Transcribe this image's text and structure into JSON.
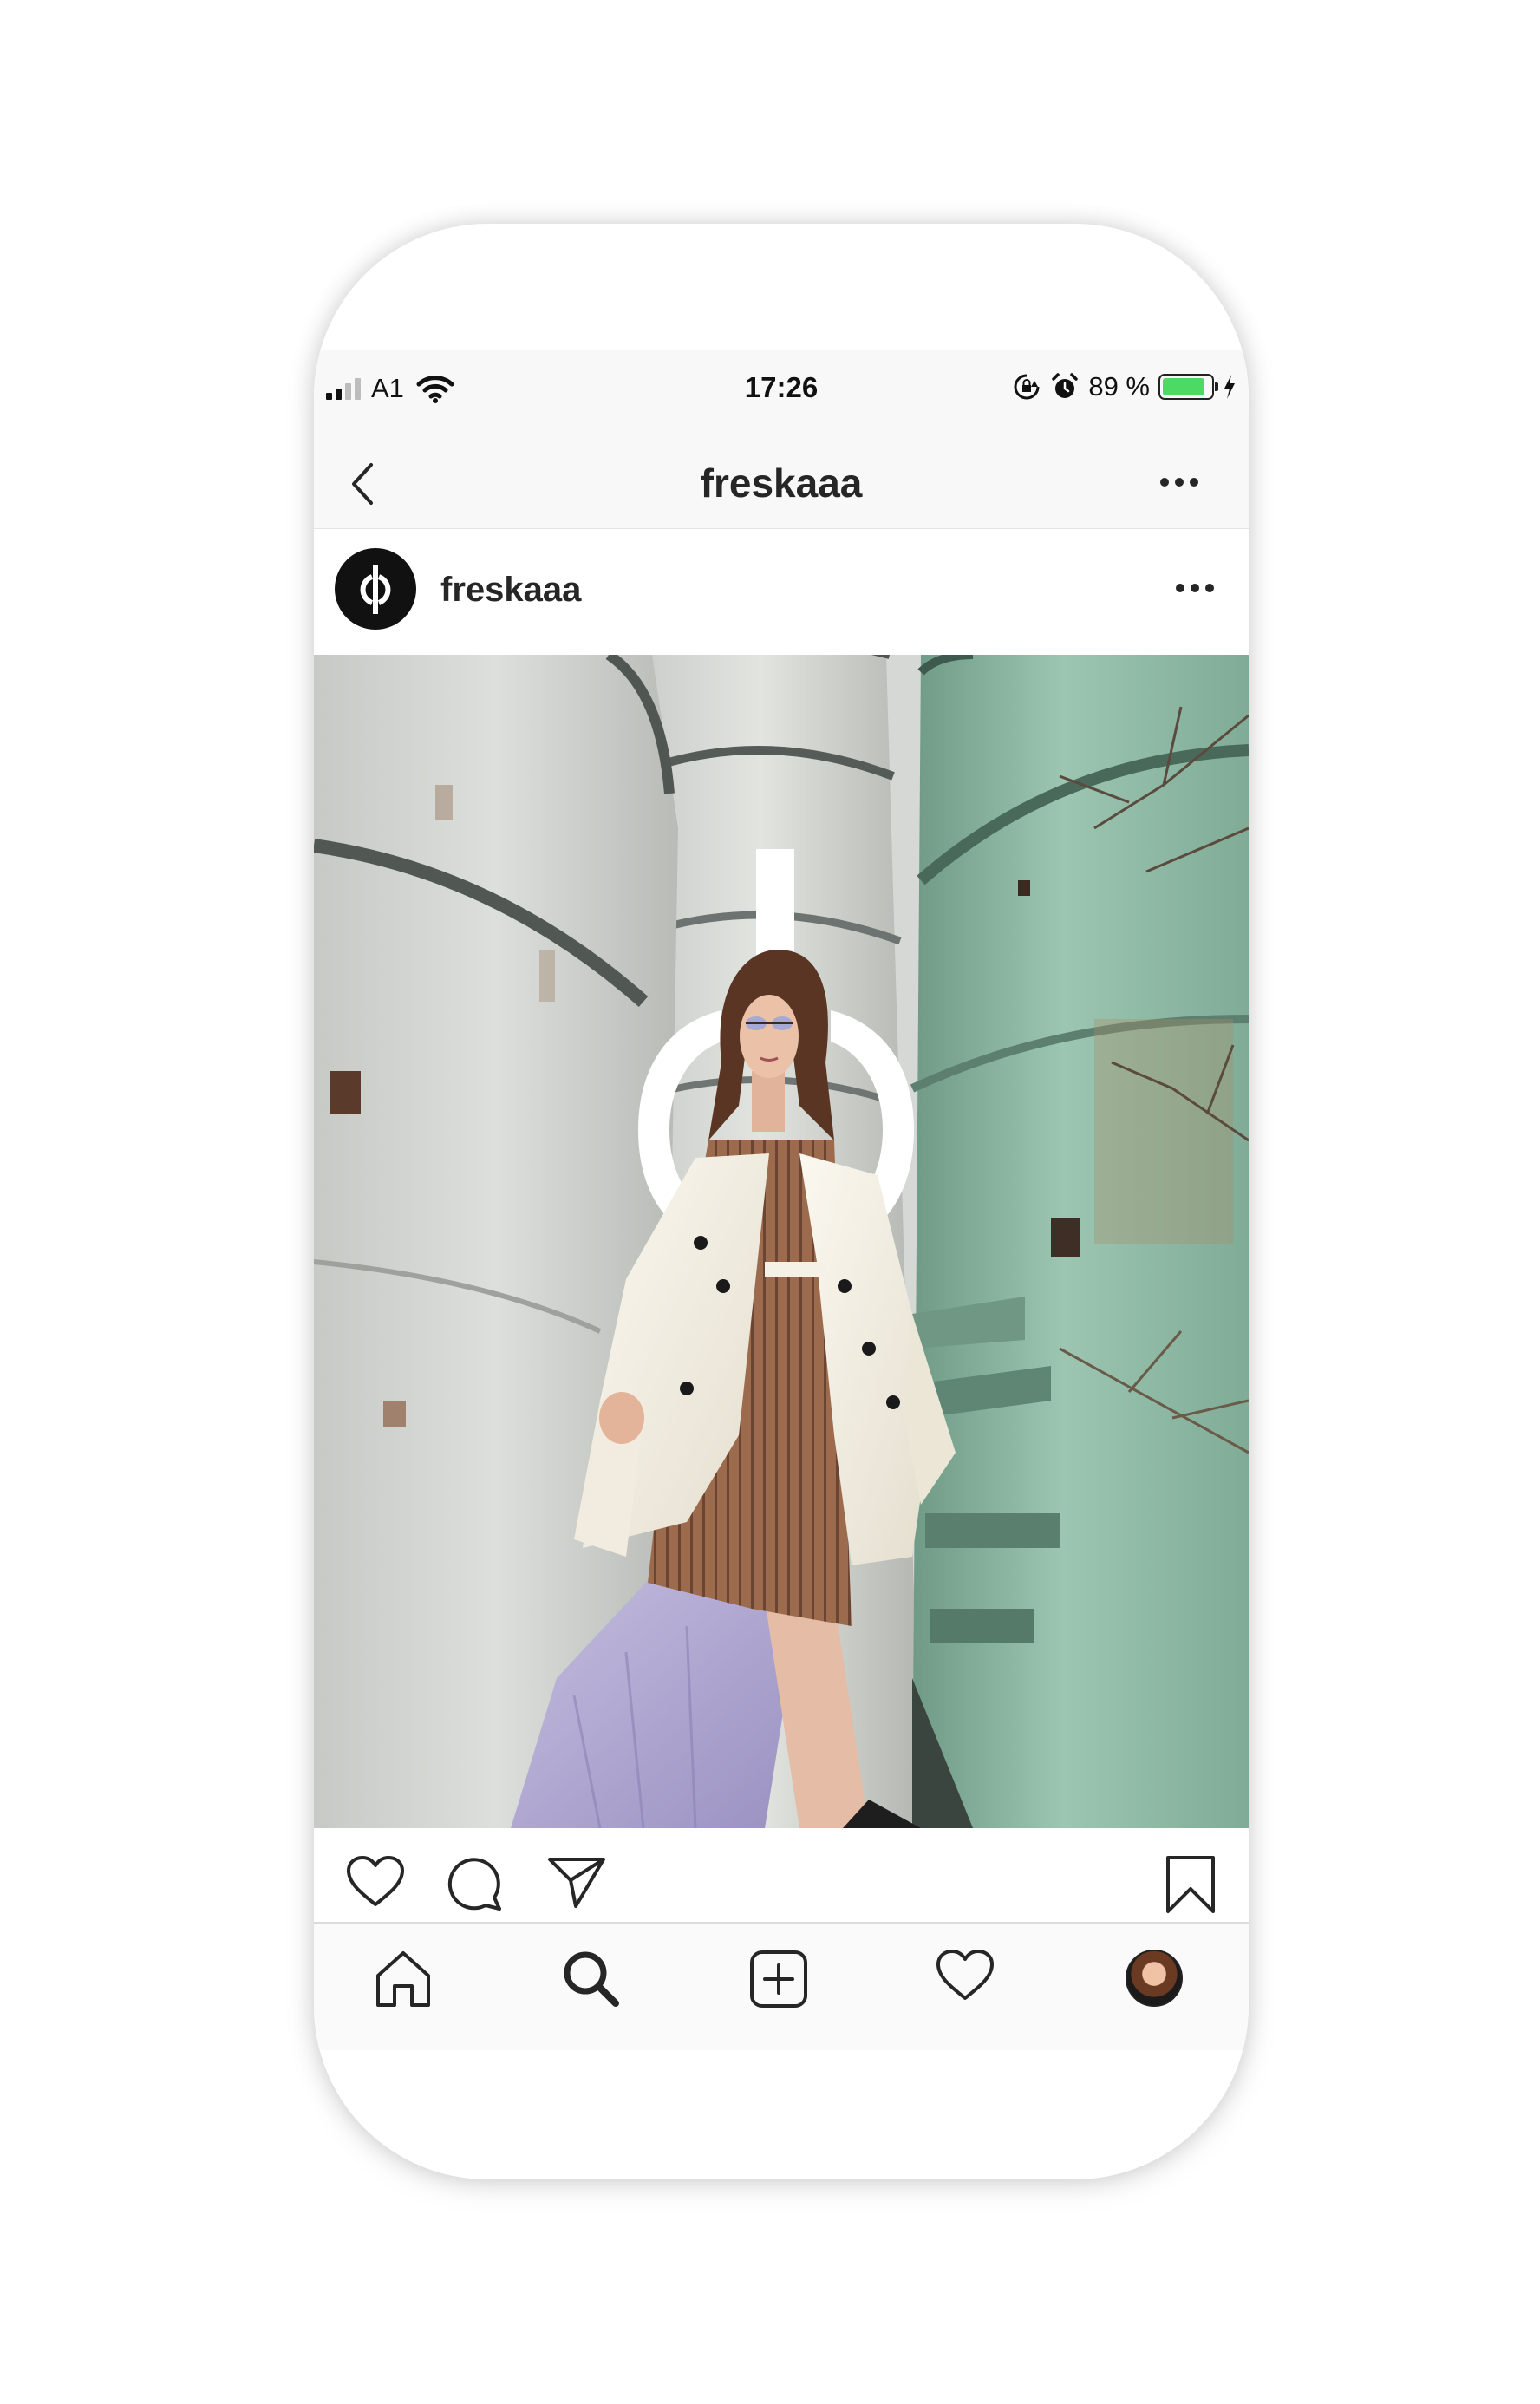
{
  "status_bar": {
    "carrier": "A1",
    "time": "17:26",
    "battery_percent": "89 %",
    "battery_level": 0.89,
    "icons": [
      "signal-icon",
      "wifi-icon",
      "orientation-lock-icon",
      "alarm-icon",
      "battery-icon",
      "charging-icon"
    ]
  },
  "nav_bar": {
    "title": "freskaaa",
    "icons": [
      "back-icon",
      "more-options-icon"
    ]
  },
  "post": {
    "username": "freskaaa",
    "avatar": "brand-logo-phi",
    "image": "fashion-photo-woman-white-coat-silos",
    "overlay_logo": "phi-logo"
  },
  "actions": {
    "icons": [
      "like-icon",
      "comment-icon",
      "share-icon",
      "save-icon"
    ]
  },
  "tab_bar": {
    "icons": [
      "home-icon",
      "search-icon",
      "new-post-icon",
      "activity-icon",
      "profile-avatar"
    ]
  },
  "colors": {
    "battery_green": "#4cd964",
    "text": "#262626",
    "silo_teal": "#8fb9a4",
    "coat_white": "#f3efe4",
    "dress_brown": "#9a6a4c",
    "skirt_lavender": "#b4acd3"
  }
}
